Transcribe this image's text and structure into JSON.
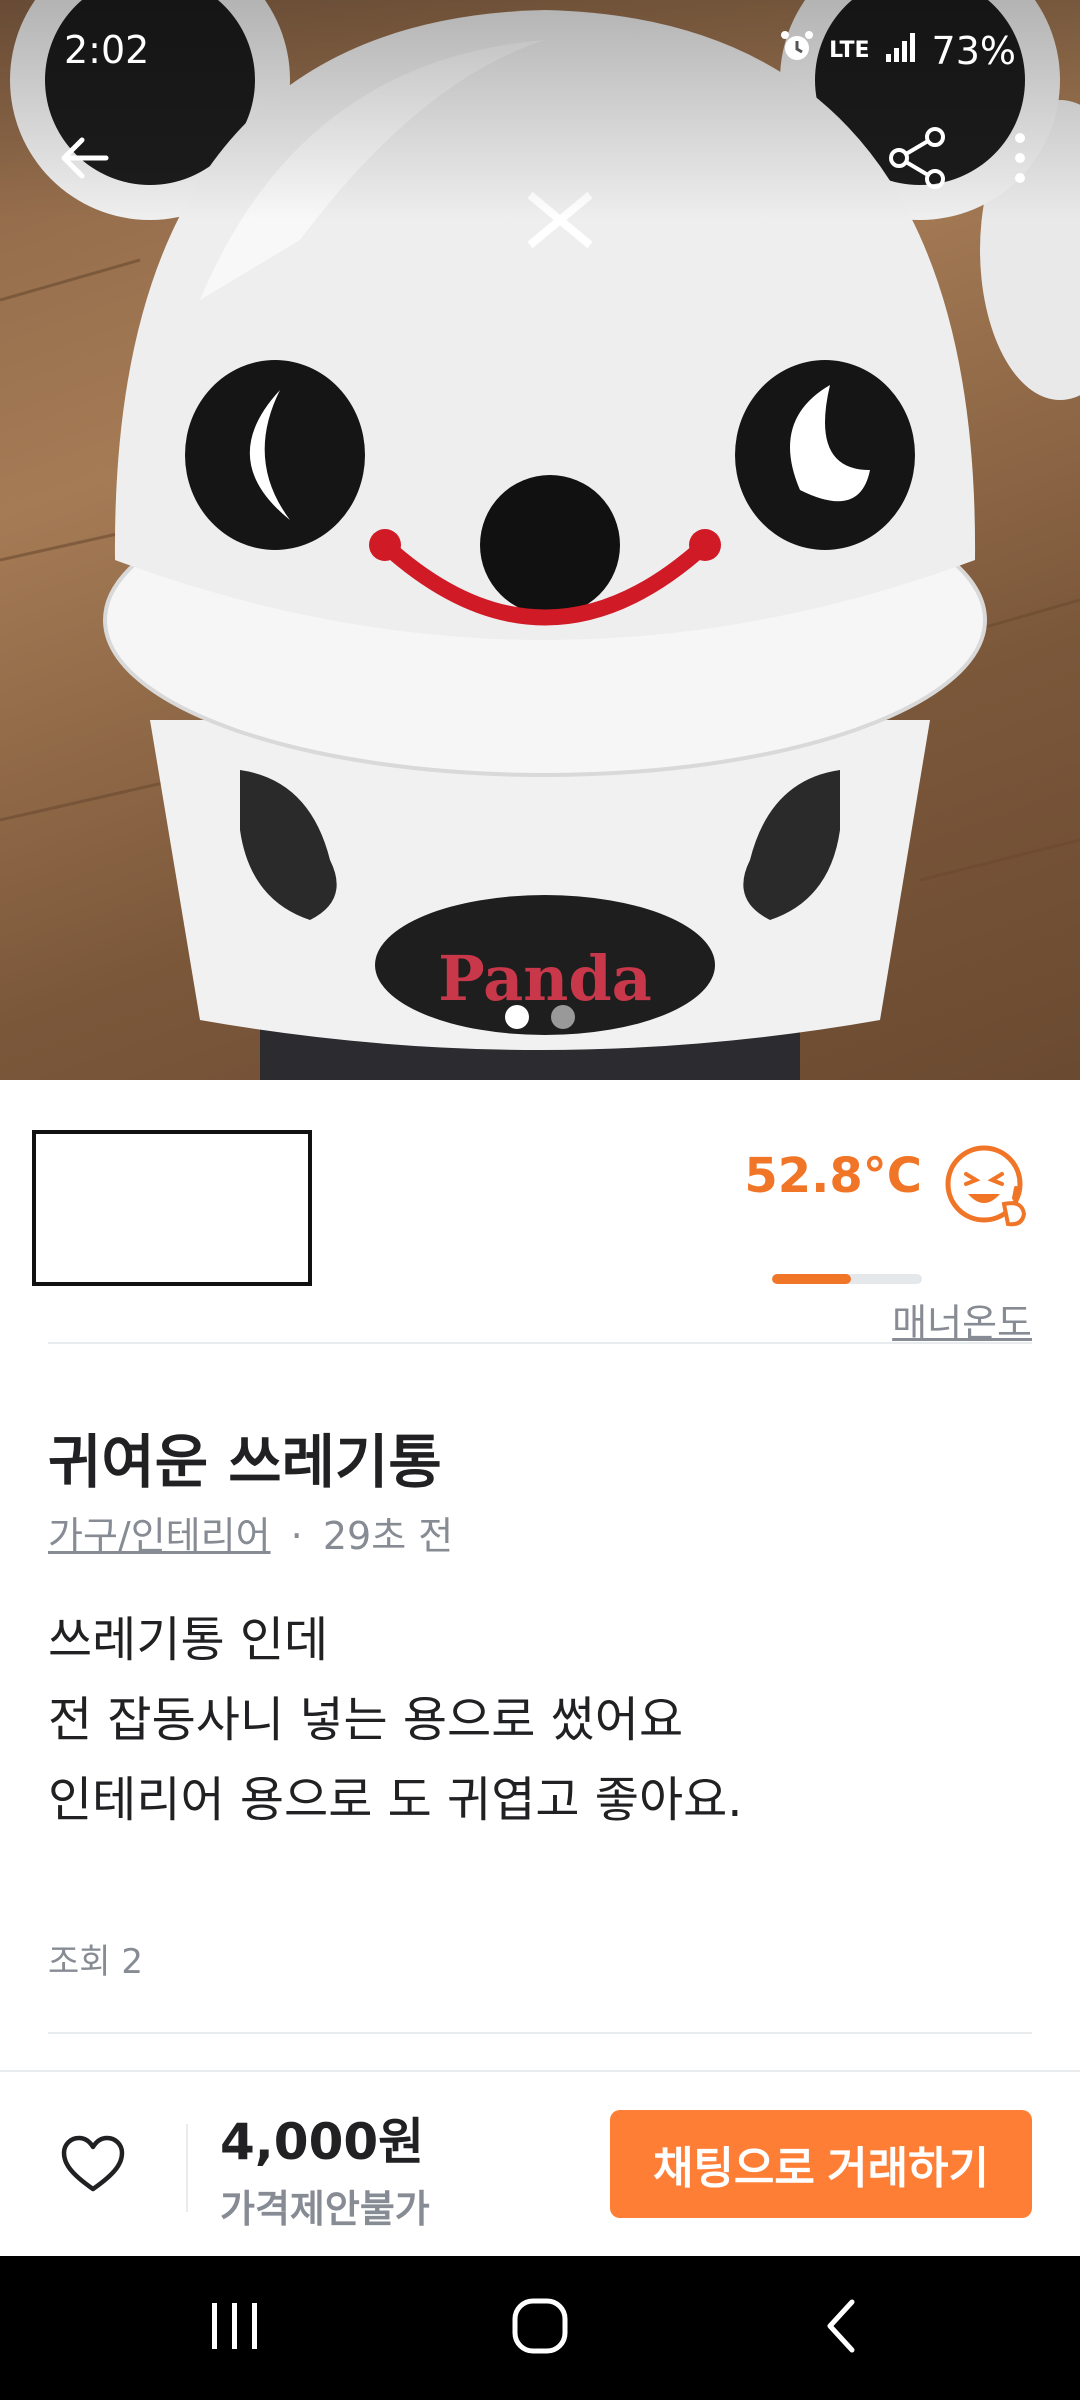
{
  "status_bar": {
    "time": "2:02",
    "network": "LTE",
    "battery": "73%"
  },
  "top_bar": {
    "back_icon": "arrow-left-icon",
    "share_icon": "share-icon",
    "more_icon": "more-vertical-icon"
  },
  "image_carousel": {
    "total": 2,
    "active_index": 0
  },
  "seller": {
    "manner_temp": "52.8°C",
    "manner_temp_fraction": 0.528,
    "manner_label": "매너온도"
  },
  "article": {
    "title": "귀여운 쓰레기통",
    "category": "가구/인테리어",
    "separator": "·",
    "time_ago": "29초 전",
    "description_lines": [
      "쓰레기통 인데",
      "전 잡동사니 넣는 용으로 썼어요",
      "인테리어 용으로 도 귀엽고 좋아요."
    ],
    "views": "조회 2"
  },
  "bottom_bar": {
    "price": "4,000원",
    "negotiation": "가격제안불가",
    "chat_button": "채팅으로 거래하기"
  },
  "colors": {
    "accent": "#ff7e36",
    "temperature": "#f07527",
    "muted_text": "#868b94",
    "text": "#212124"
  }
}
